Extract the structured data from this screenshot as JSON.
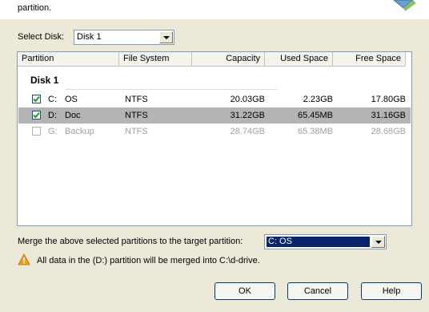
{
  "header": {
    "text": "partition."
  },
  "select_disk": {
    "label": "Select Disk:",
    "value": "Disk 1"
  },
  "table": {
    "columns": [
      "Partition",
      "File System",
      "Capacity",
      "Used Space",
      "Free Space"
    ],
    "group_title": "Disk 1",
    "rows": [
      {
        "checked": true,
        "selected": false,
        "disabled": false,
        "drive": "C:",
        "name": "OS",
        "fs": "NTFS",
        "capacity": "20.03GB",
        "used": "2.23GB",
        "free": "17.80GB"
      },
      {
        "checked": true,
        "selected": true,
        "disabled": false,
        "drive": "D:",
        "name": "Doc",
        "fs": "NTFS",
        "capacity": "31.22GB",
        "used": "65.45MB",
        "free": "31.16GB"
      },
      {
        "checked": false,
        "selected": false,
        "disabled": true,
        "drive": "G:",
        "name": "Backup",
        "fs": "NTFS",
        "capacity": "28.74GB",
        "used": "65.38MB",
        "free": "28.68GB"
      }
    ]
  },
  "merge": {
    "label": "Merge the above selected partitions to the target partition:",
    "target": "C: OS",
    "target_bg": "#0a246a"
  },
  "warning": {
    "icon": "warning-triangle-icon",
    "color": "#f0a020",
    "text": "All data in the (D:) partition will be merged into C:\\d-drive."
  },
  "buttons": {
    "ok": "OK",
    "cancel": "Cancel",
    "help": "Help"
  },
  "colors": {
    "selected_row": "#b4b4b4",
    "window_bg": "#ece9d8",
    "check_mark": "#1ea01e"
  }
}
